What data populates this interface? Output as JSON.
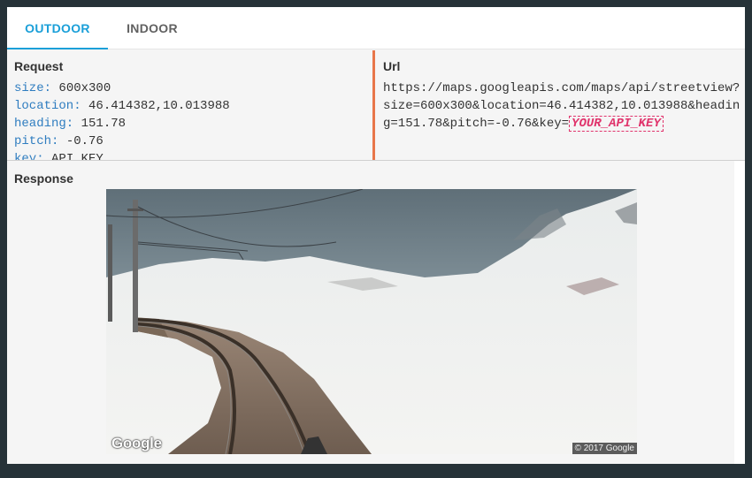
{
  "tabs": [
    {
      "label": "OUTDOOR",
      "active": true
    },
    {
      "label": "INDOOR",
      "active": false
    }
  ],
  "request": {
    "title": "Request",
    "params": [
      {
        "key": "size:",
        "value": "600x300"
      },
      {
        "key": "location:",
        "value": "46.414382,10.013988"
      },
      {
        "key": "heading:",
        "value": "151.78"
      },
      {
        "key": "pitch:",
        "value": "-0.76"
      },
      {
        "key": "key:",
        "value": "API_KEY"
      }
    ]
  },
  "url": {
    "title": "Url",
    "prefix": "https://maps.googleapis.com/maps/api/streetview?size=600x300&location=46.414382,10.013988&heading=151.78&pitch=-0.76&key=",
    "api_key": "YOUR_API_KEY"
  },
  "response": {
    "title": "Response",
    "image_logo": "Google",
    "image_copyright": "© 2017 Google"
  },
  "colors": {
    "accent": "#1a9fd8",
    "param_key": "#2f7dc0",
    "api_key": "#e0336b",
    "divider": "#e8764a"
  }
}
